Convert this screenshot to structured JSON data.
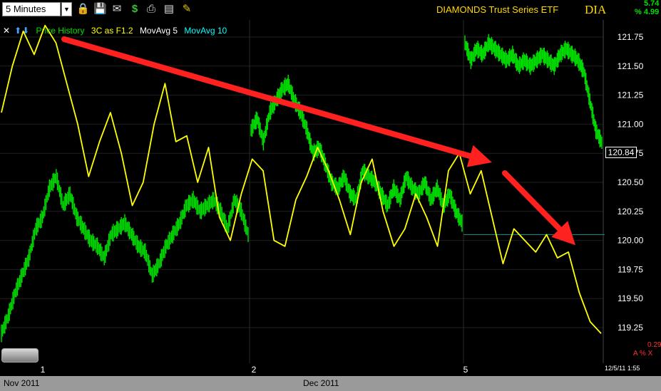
{
  "toolbar": {
    "interval": "5 Minutes",
    "icons": [
      "chevron-down-icon",
      "lock-icon",
      "save-icon",
      "mail-icon",
      "dollar-icon",
      "print-icon",
      "table-icon",
      "pencil-icon"
    ]
  },
  "header": {
    "title": "DIAMONDS Trust Series ETF",
    "symbol": "DIA",
    "change_pct_1": "5.74",
    "change_pct_2": "% 4.99"
  },
  "legend": {
    "price_history": "Price History",
    "indicator": "3C as F1.2",
    "ma5": "MovAvg 5",
    "ma10": "MovAvg 10"
  },
  "footer": {
    "month1": "Nov 2011",
    "month2": "Dec 2011",
    "timestamp": "12/5/11 1:55",
    "indicator_value": "0.29",
    "indicator_label": "A % X"
  },
  "colors": {
    "price": "#00e000",
    "indicator": "#ffff00",
    "arrow": "#ff2020",
    "ma10": "#00ffff",
    "text": "#ffd800"
  },
  "chart_data": {
    "type": "line",
    "y_axis_ticks": [
      121.75,
      121.5,
      121.25,
      121.0,
      120.75,
      120.5,
      120.25,
      120.0,
      119.75,
      119.5,
      119.25
    ],
    "ylim": [
      119.06,
      121.88
    ],
    "last_price": "120.84",
    "x_tick_labels": [
      "1",
      "2",
      "5"
    ],
    "price_series": {
      "name": "Price History",
      "sessions": [
        {
          "day": "1",
          "points": [
            119.2,
            119.35,
            119.55,
            119.7,
            119.85,
            120.1,
            120.2,
            120.45,
            120.55,
            120.3,
            120.4,
            120.2,
            120.1,
            120.0,
            119.95,
            119.85,
            120.05,
            120.1,
            120.15,
            120.05,
            119.95,
            119.9,
            119.7,
            119.8,
            119.95,
            120.05,
            120.15,
            120.3,
            120.35,
            120.25,
            120.3,
            120.35,
            120.25,
            120.1,
            120.35,
            120.25,
            120.05
          ]
        },
        {
          "day": "2",
          "points": [
            120.95,
            121.05,
            120.85,
            121.1,
            121.2,
            121.3,
            121.35,
            121.2,
            121.1,
            120.95,
            120.75,
            120.8,
            120.65,
            120.5,
            120.45,
            120.55,
            120.4,
            120.35,
            120.6,
            120.55,
            120.5,
            120.4,
            120.3,
            120.45,
            120.35,
            120.55,
            120.45,
            120.4,
            120.5,
            120.35,
            120.45,
            120.3,
            120.4,
            120.25,
            120.15
          ]
        },
        {
          "day": "5",
          "points": [
            121.7,
            121.55,
            121.65,
            121.6,
            121.7,
            121.65,
            121.6,
            121.55,
            121.6,
            121.5,
            121.55,
            121.5,
            121.55,
            121.6,
            121.55,
            121.5,
            121.6,
            121.65,
            121.6,
            121.55,
            121.45,
            121.2,
            120.95,
            120.84
          ]
        }
      ]
    },
    "indicator_series": {
      "name": "3C as F1.2",
      "points": [
        121.1,
        121.5,
        121.8,
        121.6,
        121.85,
        121.7,
        121.35,
        121.0,
        120.55,
        120.85,
        121.1,
        120.75,
        120.3,
        120.5,
        121.0,
        121.35,
        120.85,
        120.9,
        120.5,
        120.8,
        120.2,
        120.0,
        120.4,
        120.7,
        120.6,
        120.0,
        119.95,
        120.35,
        120.55,
        120.8,
        120.6,
        120.35,
        120.05,
        120.5,
        120.7,
        120.25,
        119.95,
        120.1,
        120.4,
        120.2,
        119.95,
        120.6,
        120.75,
        120.4,
        120.6,
        120.2,
        119.8,
        120.1,
        120.0,
        119.9,
        120.05,
        119.85,
        119.9,
        119.55,
        119.3,
        119.2
      ]
    },
    "ma10_level": 120.05,
    "annotations": [
      {
        "type": "arrow",
        "from": {
          "x": "1",
          "y": 121.88
        },
        "to": {
          "x": "5",
          "y": 120.75
        }
      },
      {
        "type": "arrow",
        "from": {
          "x": "5",
          "y": 120.7
        },
        "to": {
          "x": "5",
          "y": 120.0
        }
      }
    ]
  }
}
